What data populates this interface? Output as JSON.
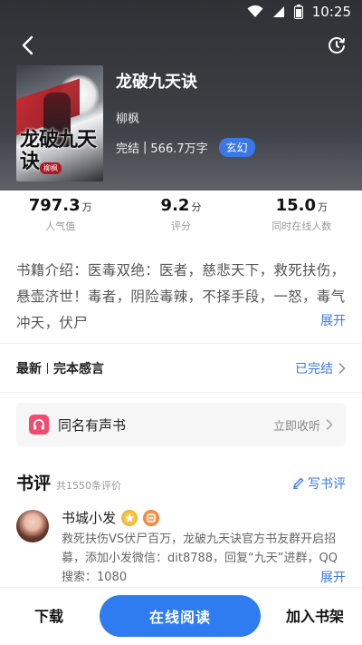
{
  "status_bar": {
    "time": "10:25",
    "icons": [
      "wifi-icon",
      "signal-icon",
      "battery-icon"
    ]
  },
  "header": {
    "icons": {
      "back": "back-arrow-icon",
      "history": "history-icon"
    }
  },
  "book": {
    "cover_title": "龙破九天诀",
    "cover_author": "柳枫",
    "title": "龙破九天诀",
    "author": "柳枫",
    "status": "完结",
    "separator": "|",
    "word_count": "566.7万字",
    "genre": "玄幻"
  },
  "stats": [
    {
      "value": "797.3",
      "unit": "万",
      "label": "人气值"
    },
    {
      "value": "9.2",
      "unit": "分",
      "label": "评分"
    },
    {
      "value": "15.0",
      "unit": "万",
      "label": "同时在线人数"
    }
  ],
  "intro": {
    "text": "书籍介绍：医毒双绝：医者，慈悲天下，救死扶伤，悬壶济世！毒者，阴险毒辣，不择手段，一怒，毒气冲天，伏尸",
    "expand_label": "展开"
  },
  "latest": {
    "label": "最新",
    "chapter": "完本感言",
    "status": "已完结"
  },
  "audio": {
    "title": "同名有声书",
    "action": "立即收听"
  },
  "reviews": {
    "title": "书评",
    "count_text": "共1550条评价",
    "write_label": "写书评",
    "items": [
      {
        "name": "书城小发",
        "text": "救死扶伤VS伏尸百万，龙破九天诀官方书友群开启招募，添加小发微信：dit8788，回复“九天”进群，QQ搜索：1080",
        "expand_label": "展开"
      }
    ]
  },
  "bottom_bar": {
    "download_label": "下载",
    "read_label": "在线阅读",
    "shelf_label": "加入书架"
  },
  "colors": {
    "accent": "#2f7bf0",
    "link": "#3a78e8",
    "audio_icon_bg": "#f24b70"
  }
}
